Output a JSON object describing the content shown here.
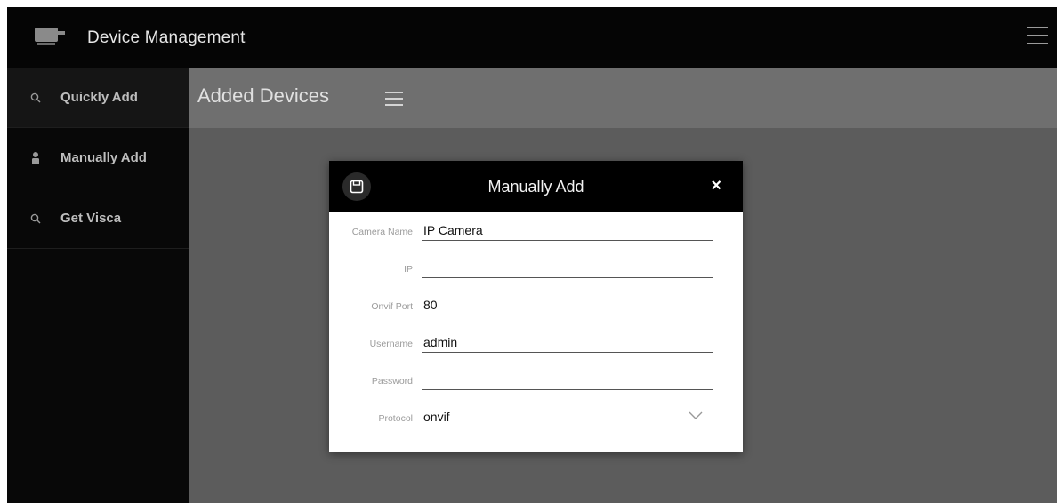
{
  "header": {
    "title": "Device Management",
    "app_icon": "camera-icon",
    "menu_icon": "hamburger-menu-icon"
  },
  "sidebar": {
    "items": [
      {
        "label": "Quickly Add",
        "icon": "search-icon",
        "active": true
      },
      {
        "label": "Manually Add",
        "icon": "person-icon",
        "active": false
      },
      {
        "label": "Get Visca",
        "icon": "search-icon",
        "active": false
      }
    ]
  },
  "content": {
    "title": "Added Devices",
    "menu_icon": "hamburger-menu-icon"
  },
  "dialog": {
    "title": "Manually Add",
    "save_icon": "floppy-disk-icon",
    "close_label": "×",
    "fields": [
      {
        "label": "Camera Name",
        "value": "IP Camera",
        "placeholder": ""
      },
      {
        "label": "IP",
        "value": "",
        "placeholder": ""
      },
      {
        "label": "Onvif Port",
        "value": "80",
        "placeholder": ""
      },
      {
        "label": "Username",
        "value": "admin",
        "placeholder": ""
      },
      {
        "label": "Password",
        "value": "",
        "placeholder": ""
      }
    ],
    "protocol": {
      "label": "Protocol",
      "value": "onvif",
      "icon": "chevron-down-icon"
    }
  },
  "colors": {
    "topbar": "#050505",
    "sidebar": "#080808",
    "content_bg": "#5c5c5c",
    "content_header": "#6f6f6f",
    "dialog_header": "#000000"
  }
}
